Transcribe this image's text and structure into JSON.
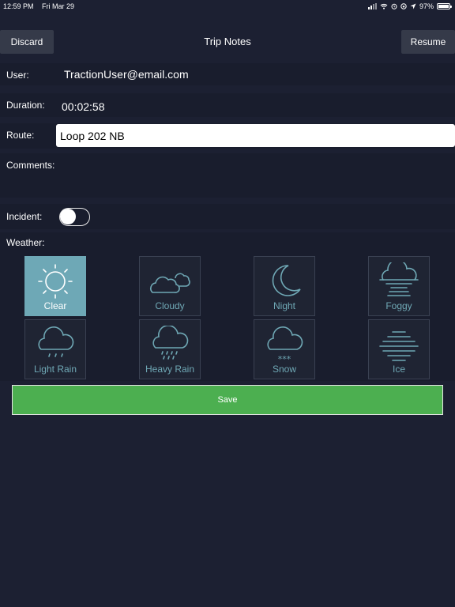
{
  "status_bar": {
    "time": "12:59 PM",
    "date": "Fri Mar 29",
    "battery": "97%"
  },
  "header": {
    "title": "Trip Notes",
    "discard_label": "Discard",
    "resume_label": "Resume"
  },
  "form": {
    "user_label": "User:",
    "user_value": "TractionUser@email.com",
    "duration_label": "Duration:",
    "duration_value": "00:02:58",
    "route_label": "Route:",
    "route_value": "Loop 202 NB",
    "comments_label": "Comments:",
    "incident_label": "Incident:",
    "incident_on": false,
    "weather_label": "Weather:"
  },
  "weather_options": [
    {
      "label": "Clear",
      "icon": "sun-icon",
      "selected": true
    },
    {
      "label": "Cloudy",
      "icon": "cloudy-icon",
      "selected": false
    },
    {
      "label": "Night",
      "icon": "moon-icon",
      "selected": false
    },
    {
      "label": "Foggy",
      "icon": "fog-icon",
      "selected": false
    },
    {
      "label": "Light Rain",
      "icon": "light-rain-icon",
      "selected": false
    },
    {
      "label": "Heavy Rain",
      "icon": "heavy-rain-icon",
      "selected": false
    },
    {
      "label": "Snow",
      "icon": "snow-icon",
      "selected": false
    },
    {
      "label": "Ice",
      "icon": "ice-icon",
      "selected": false
    }
  ],
  "save_label": "Save",
  "colors": {
    "background": "#1c2032",
    "row": "#191d2d",
    "accent": "#6ea8b6",
    "save": "#4caf50"
  }
}
